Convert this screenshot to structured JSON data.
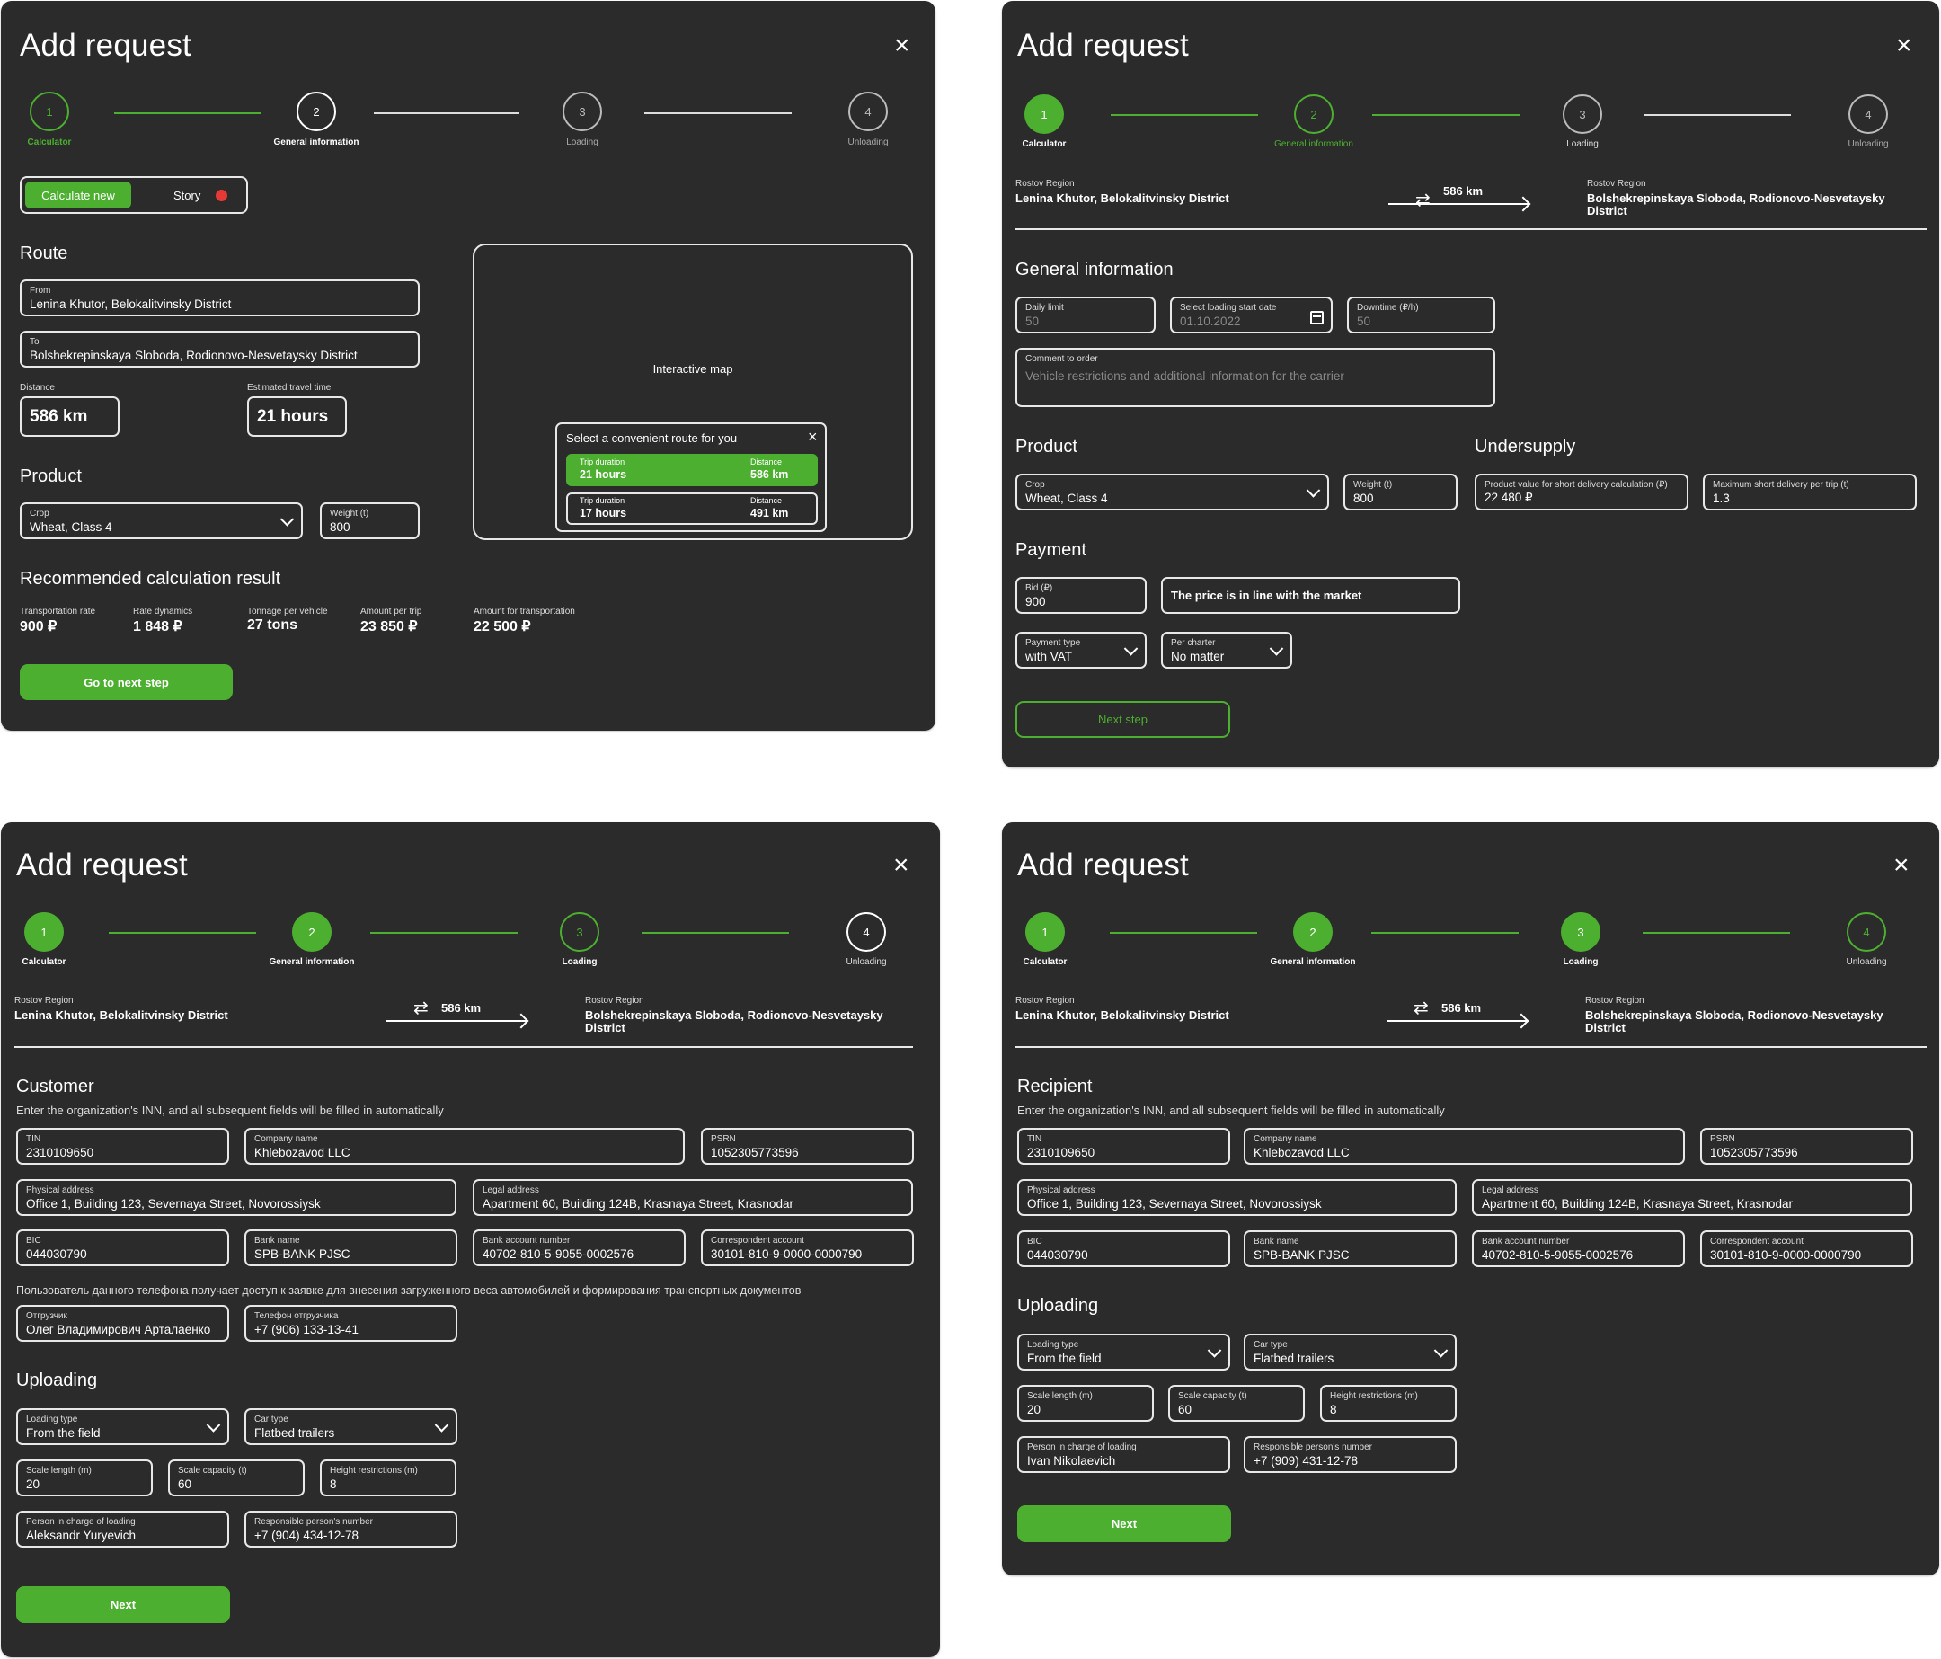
{
  "common": {
    "title": "Add request",
    "close": "×",
    "steps": [
      "1",
      "2",
      "3",
      "4"
    ],
    "step_labels": [
      "Calculator",
      "General information",
      "Loading",
      "Unloading"
    ],
    "from_region": "Rostov Region",
    "from_place": "Lenina Khutor, Belokalitvinsky District",
    "to_region": "Rostov Region",
    "to_place_1": "Bolshekrepinskaya Sloboda, Rodionovo-Nesvetaysky",
    "to_place_2": "District",
    "distance": "586 km",
    "inn_hint": "Enter the organization's INN, and all subsequent fields will be filled in automatically",
    "lbl_tin": "TIN",
    "tin": "2310109650",
    "lbl_company": "Company name",
    "company": "Khlebozavod LLC",
    "lbl_psrn": "PSRN",
    "psrn": "1052305773596",
    "lbl_phys": "Physical address",
    "phys": "Office 1, Building 123, Severnaya Street, Novorossiysk",
    "lbl_legal": "Legal address",
    "legal": "Apartment 60, Building 124B, Krasnaya Street, Krasnodar",
    "lbl_bic": "BIC",
    "bic": "044030790",
    "lbl_bank": "Bank name",
    "bank": "SPB-BANK PJSC",
    "lbl_acc": "Bank account number",
    "acc": "40702-810-5-9055-0002576",
    "lbl_corr": "Correspondent account",
    "corr": "30101-810-9-0000-0000790",
    "uploading": "Uploading",
    "lbl_loading_type": "Loading type",
    "loading_type": "From the field",
    "lbl_car_type": "Car type",
    "car_type": "Flatbed trailers",
    "lbl_scale_len": "Scale length (m)",
    "scale_len": "20",
    "lbl_scale_cap": "Scale capacity (t)",
    "scale_cap": "60",
    "lbl_height": "Height restrictions (m)",
    "height": "8",
    "lbl_person": "Person in charge of loading",
    "lbl_resp_phone": "Responsible person's number",
    "next": "Next"
  },
  "p1": {
    "tab_calc": "Calculate new",
    "tab_story": "Story",
    "route": "Route",
    "lbl_from": "From",
    "from": "Lenina Khutor, Belokalitvinsky District",
    "lbl_to": "To",
    "to": "Bolshekrepinskaya Sloboda, Rodionovo-Nesvetaysky District",
    "lbl_distance": "Distance",
    "distance": "586 km",
    "lbl_time": "Estimated travel time",
    "time": "21 hours",
    "product": "Product",
    "lbl_crop": "Crop",
    "crop": "Wheat, Class 4",
    "lbl_weight": "Weight (t)",
    "weight": "800",
    "map": "Interactive map",
    "route_pick": "Select a convenient route for you",
    "lbl_trip": "Trip duration",
    "lbl_dist": "Distance",
    "r1_time": "21 hours",
    "r1_dist": "586 km",
    "r2_time": "17 hours",
    "r2_dist": "491 km",
    "result": "Recommended calculation result",
    "lbl_rate": "Transportation rate",
    "rate": "900 ₽",
    "lbl_dyn": "Rate dynamics",
    "dyn": "1 848 ₽",
    "lbl_ton": "Tonnage per vehicle",
    "ton": "27 tons",
    "lbl_amt": "Amount per trip",
    "amt": "23 850 ₽",
    "lbl_total": "Amount for transportation",
    "total": "22 500 ₽",
    "next": "Go to next step"
  },
  "p2": {
    "general": "General information",
    "lbl_daily": "Daily limit",
    "daily": "50",
    "lbl_date": "Select loading start date",
    "date": "01.10.2022",
    "lbl_down": "Downtime (₽/h)",
    "down": "50",
    "lbl_comment": "Comment to order",
    "comment": "Vehicle restrictions and additional information for the carrier",
    "product": "Product",
    "undersupply": "Undersupply",
    "lbl_crop": "Crop",
    "crop": "Wheat, Class 4",
    "lbl_weight": "Weight (t)",
    "weight": "800",
    "lbl_value": "Product value for short delivery calculation (₽)",
    "value": "22 480 ₽",
    "lbl_max": "Maximum short delivery per trip (t)",
    "max": "1.3",
    "payment": "Payment",
    "lbl_bid": "Bid (₽)",
    "bid": "900",
    "market": "The price is in line with the market",
    "lbl_pay_type": "Payment type",
    "pay_type": "with VAT",
    "lbl_charter": "Per charter",
    "charter": "No matter",
    "next": "Next step"
  },
  "p3": {
    "customer": "Customer",
    "phone_hint": "Пользователь данного телефона получает доступ к заявке для внесения загруженного веса автомобилей и формирования транспортных документов",
    "lbl_shipper": "Отгрузчик",
    "shipper": "Олег Владимирович Арталаенко",
    "lbl_shipper_phone": "Телефон отгрузчика",
    "shipper_phone": "+7 (906) 133-13-41",
    "person": "Aleksandr Yuryevich",
    "resp_phone": "+7 (904) 434-12-78"
  },
  "p4": {
    "recipient": "Recipient",
    "person": "Ivan Nikolaevich",
    "resp_phone": "+7 (909) 431-12-78"
  },
  "colors": {
    "accent": "#4caf30",
    "panel": "#2b2b2b",
    "badge": "#e53935"
  }
}
